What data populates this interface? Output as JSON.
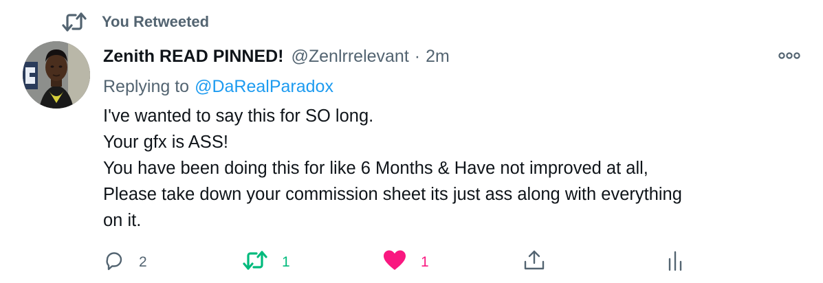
{
  "context": {
    "label": "You Retweeted",
    "icon": "retweet-icon"
  },
  "tweet": {
    "display_name": "Zenith READ PINNED!",
    "handle": "@Zenlrrelevant",
    "separator": "·",
    "time": "2m",
    "replying_to_prefix": "Replying to",
    "replying_to_handle": "@DaRealParadox",
    "body_lines": [
      "I've wanted to say this for SO long.",
      "Your gfx is ASS!",
      "You have been doing this for like 6 Months & Have not improved at all,",
      "Please take down your commission sheet its just ass along with everything",
      "on it."
    ]
  },
  "actions": {
    "reply_count": "2",
    "retweet_count": "1",
    "like_count": "1"
  },
  "colors": {
    "muted": "#536471",
    "link": "#1d9bf0",
    "retweet_active": "#00ba7c",
    "like_active": "#f91880"
  }
}
